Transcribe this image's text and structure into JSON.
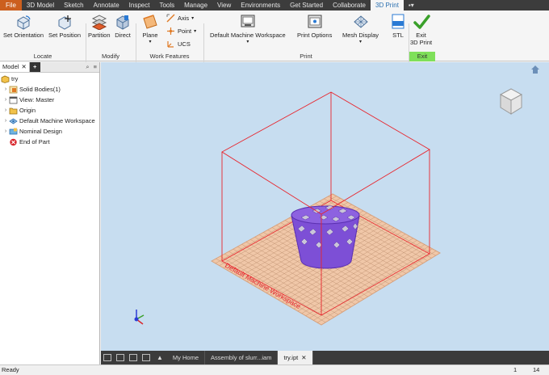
{
  "ribbon_tabs": [
    "File",
    "3D Model",
    "Sketch",
    "Annotate",
    "Inspect",
    "Tools",
    "Manage",
    "View",
    "Environments",
    "Get Started",
    "Collaborate",
    "3D Print"
  ],
  "ribbon": {
    "set_orientation": "Set Orientation",
    "set_position": "Set Position",
    "partition": "Partition",
    "direct": "Direct",
    "plane": "Plane",
    "axis": "Axis",
    "point": "Point",
    "ucs": "UCS",
    "default_machine_workspace": "Default Machine Workspace",
    "print_options": "Print Options",
    "mesh_display": "Mesh Display",
    "stl": "STL",
    "exit_line1": "Exit",
    "exit_line2": "3D Print",
    "groups": {
      "locate": "Locate",
      "modify": "Modify",
      "work_features": "Work Features",
      "print": "Print",
      "exit": "Exit"
    }
  },
  "browser": {
    "tab_label": "Model",
    "add": "+",
    "items": [
      "try",
      "Solid Bodies(1)",
      "View: Master",
      "Origin",
      "Default Machine Workspace",
      "Nominal Design",
      "End of Part"
    ]
  },
  "viewport": {
    "workspace_label": "Default Machine Workspace"
  },
  "doc_tabs": {
    "home": "My Home",
    "assembly": "Assembly of slurr...iam",
    "active": "try.ipt"
  },
  "status": {
    "text": "Ready",
    "value1": "1",
    "value2": "14"
  },
  "colors": {
    "file_tab": "#cc5f1e",
    "viewport_bg": "#c7ddf0",
    "bounding_box": "#e8242c",
    "part": "#7d4fd6",
    "exit_group": "#7fe05a"
  }
}
